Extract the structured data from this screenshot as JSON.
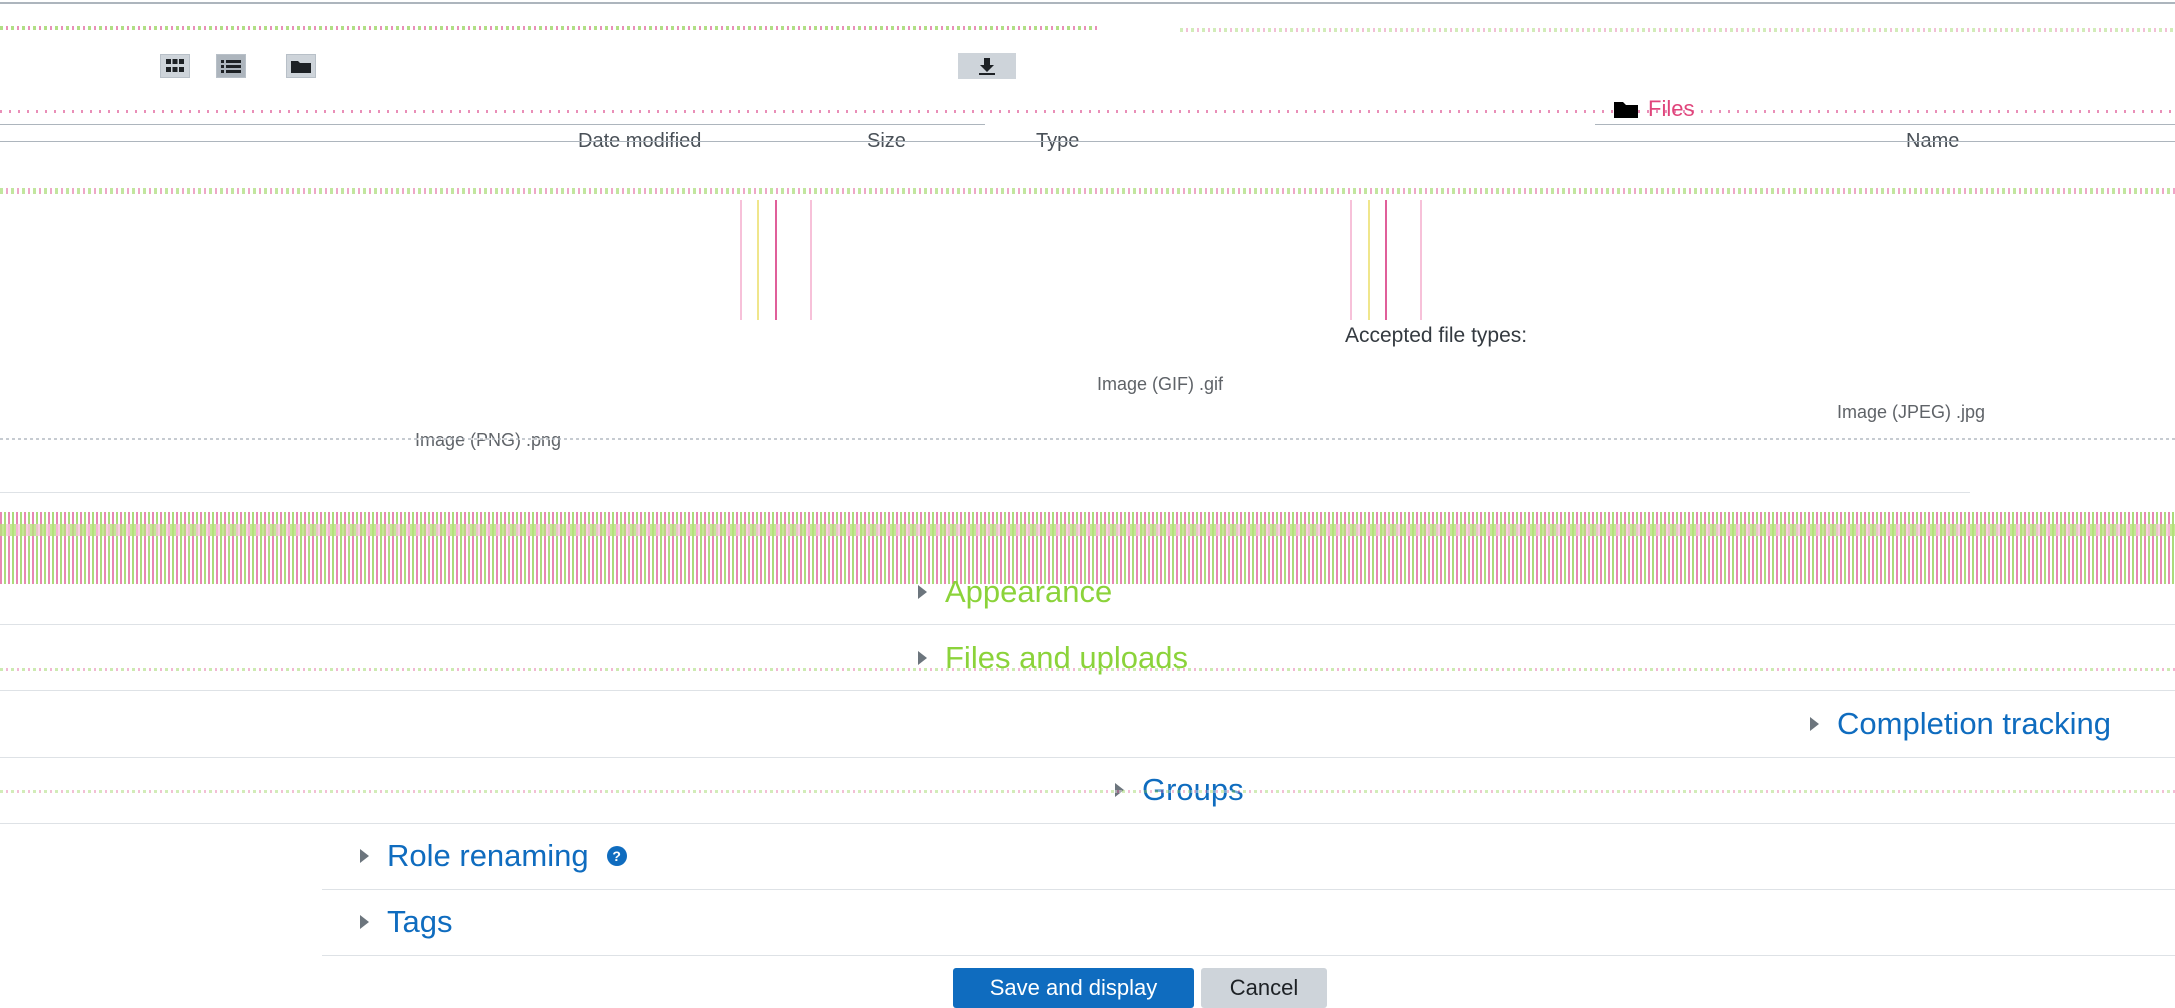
{
  "filepicker": {
    "view_icons": [
      "grid-icon",
      "list-icon",
      "folder-icon"
    ],
    "download_icon": "download-icon",
    "files_label": "Files",
    "columns": {
      "date_modified": "Date modified",
      "size": "Size",
      "type": "Type",
      "name": "Name"
    }
  },
  "accepted": {
    "heading": "Accepted file types:",
    "types": [
      "Image (GIF) .gif",
      "Image (JPEG) .jpg",
      "Image (PNG) .png"
    ]
  },
  "sections": [
    {
      "label": "Appearance"
    },
    {
      "label": "Files and uploads"
    },
    {
      "label": "Completion tracking"
    },
    {
      "label": "Groups"
    },
    {
      "label": "Role renaming"
    },
    {
      "label": "Tags"
    }
  ],
  "buttons": {
    "save": "Save and display",
    "cancel": "Cancel"
  },
  "colors": {
    "link": "#0f6cbf",
    "primary": "#0f6cbf",
    "files_link": "#e0457b",
    "section_green": "#8bd33a"
  }
}
